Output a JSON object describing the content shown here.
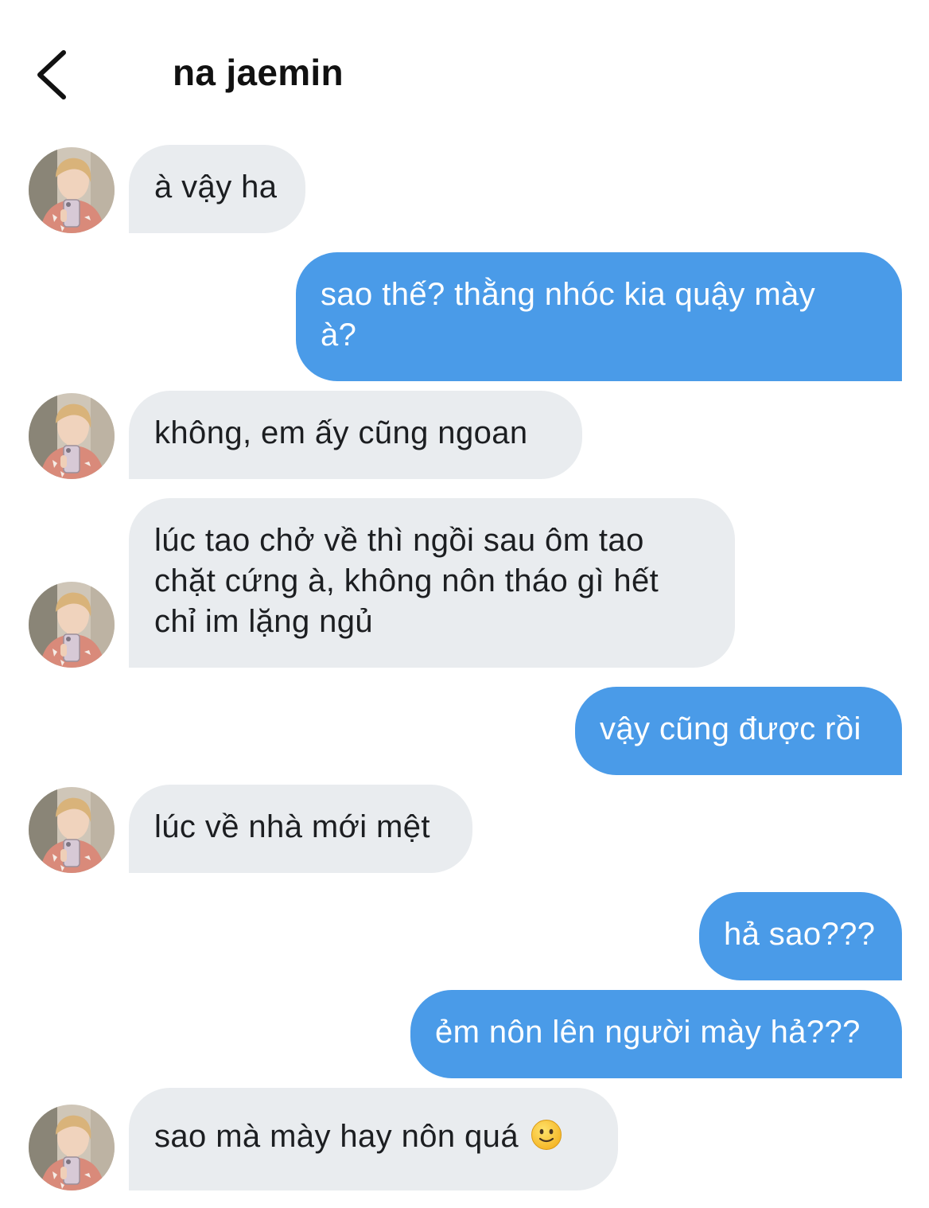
{
  "header": {
    "title": "na jaemin",
    "back_icon": "chevron-left-icon"
  },
  "contact": {
    "avatar_icon": "avatar-photo"
  },
  "colors": {
    "outgoing_bubble": "#4a9be8",
    "incoming_bubble": "#e9ecef",
    "incoming_text": "#1c1e21",
    "outgoing_text": "#ffffff"
  },
  "messages": [
    {
      "from": "them",
      "text": "à vậy ha"
    },
    {
      "from": "me",
      "text": "sao thế? thằng nhóc kia quậy mày\nà?"
    },
    {
      "from": "them",
      "text": "không, em ấy cũng ngoan"
    },
    {
      "from": "them",
      "text": "lúc tao chở về thì ngồi sau ôm tao\nchặt cứng à, không nôn tháo gì hết\nchỉ im lặng ngủ"
    },
    {
      "from": "me",
      "text": "vậy cũng được rồi"
    },
    {
      "from": "them",
      "text": "lúc về nhà mới mệt"
    },
    {
      "from": "me",
      "text": "hả sao???"
    },
    {
      "from": "me",
      "text": "ẻm nôn lên người mày hả???"
    },
    {
      "from": "them",
      "text": "sao mà mày hay nôn quá",
      "emoji": "slightly-smiling-face-icon"
    }
  ]
}
